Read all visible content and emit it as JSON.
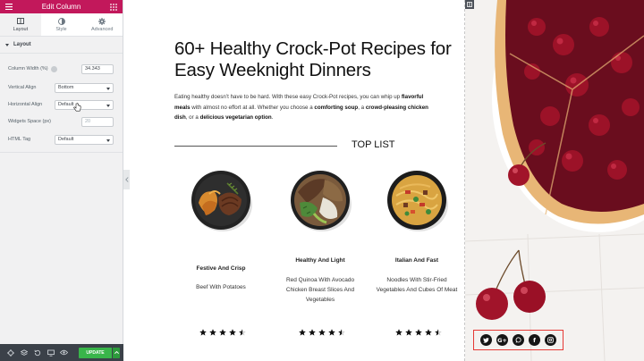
{
  "panel": {
    "title": "Edit Column",
    "tabs": [
      {
        "label": "Layout",
        "icon": "layout-icon"
      },
      {
        "label": "Style",
        "icon": "style-icon"
      },
      {
        "label": "Advanced",
        "icon": "gear-icon"
      }
    ],
    "section": "Layout",
    "controls": {
      "column_width": {
        "label": "Column Width (%)",
        "value": "34.343"
      },
      "vertical_align": {
        "label": "Vertical Align",
        "value": "Bottom"
      },
      "horizontal_align": {
        "label": "Horizontal Align",
        "value": "Default"
      },
      "widgets_space": {
        "label": "Widgets Space (px)",
        "placeholder": "20"
      },
      "html_tag": {
        "label": "HTML Tag",
        "value": "Default"
      }
    },
    "footer": {
      "update_label": "UPDATE",
      "icons": [
        "settings-icon",
        "layers-icon",
        "history-icon",
        "responsive-icon",
        "preview-icon"
      ]
    }
  },
  "content": {
    "headline": "60+ Healthy Crock-Pot Recipes for Easy Weeknight Dinners",
    "intro": {
      "p1": "Eating healthy doesn’t have to be hard. With these easy Crock-Pot recipes, you can whip up ",
      "b1": "flavorful meals",
      "p2": " with almost no effort at all. Whether you choose a ",
      "b2": "comforting soup",
      "p3": ", a ",
      "b3": "crowd-pleasing chicken dish",
      "p4": ", or a ",
      "b4": "delicious vegetarian option",
      "p5": "."
    },
    "top_list": "TOP LIST",
    "cards": [
      {
        "title": "Festive And Crisp",
        "desc": "Beef With Potatoes",
        "rating": 4.5
      },
      {
        "title": "Healthy And Light",
        "desc": "Red Quinoa With Avocado Chicken Breast Slices And Vegetables",
        "rating": 4.5
      },
      {
        "title": "Italian And Fast",
        "desc": "Noodles With Stir-Fried Vegetables And Cubes Of Meat",
        "rating": 4.5
      }
    ]
  },
  "social": [
    "twitter-icon",
    "google-plus-icon",
    "whatsapp-icon",
    "facebook-icon",
    "instagram-icon"
  ],
  "colors": {
    "brand": "#c2185b",
    "update": "#39b54a",
    "panel_dark": "#3b4149",
    "highlight": "#e53935"
  }
}
